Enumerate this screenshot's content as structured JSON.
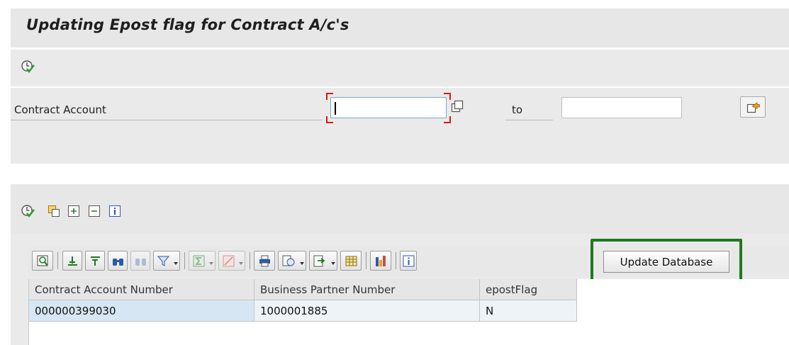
{
  "header": {
    "title": "Updating Epost flag for Contract A/c's"
  },
  "selection": {
    "field_label": "Contract Account",
    "from_value": "",
    "to_label": "to",
    "to_value": ""
  },
  "icons": {
    "execute": "execute-icon",
    "multiple_selection": "multiple-selection-icon",
    "more_selection": "more-selection-icon"
  },
  "alv": {
    "update_button_label": "Update Database",
    "columns": [
      "Contract Account Number",
      "Business Partner Number",
      "epostFlag"
    ],
    "rows": [
      [
        "000000399030",
        "1000001885",
        "N"
      ]
    ]
  },
  "colors": {
    "highlight_border": "#1f7a1f",
    "required_marker": "#e01515"
  }
}
